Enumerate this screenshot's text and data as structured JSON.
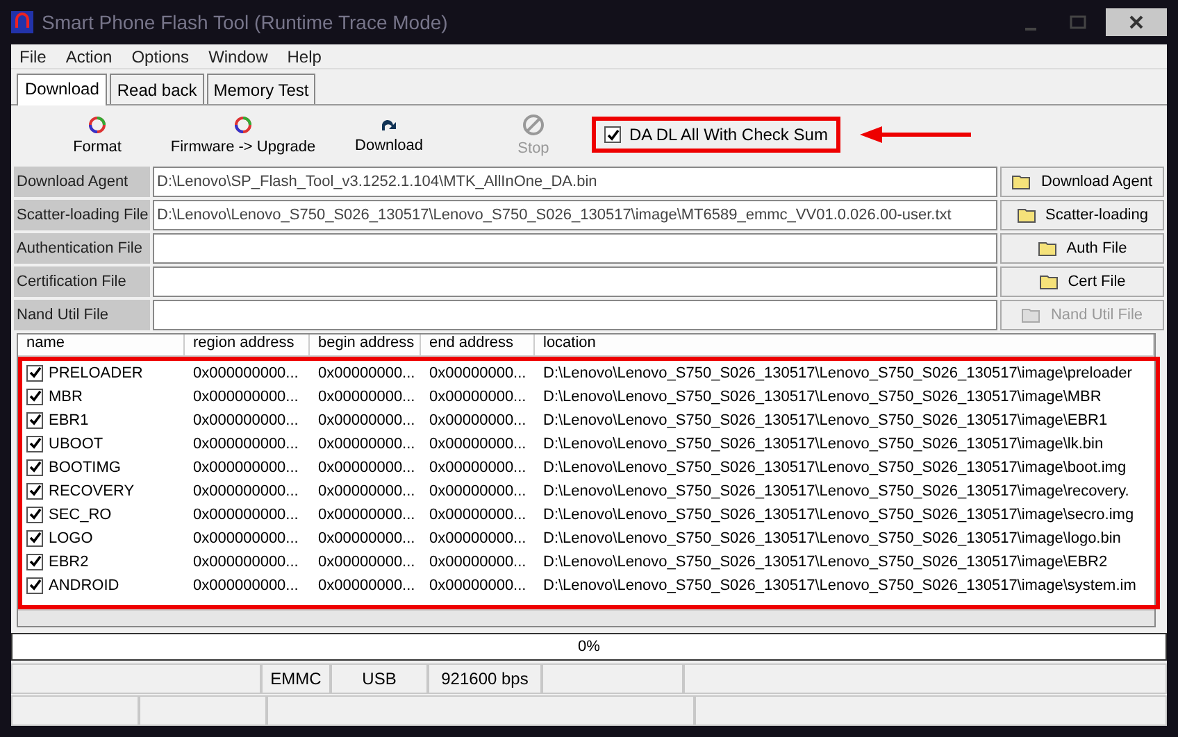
{
  "window": {
    "title": "Smart Phone Flash Tool (Runtime Trace Mode)"
  },
  "menu": [
    "File",
    "Action",
    "Options",
    "Window",
    "Help"
  ],
  "tabs": [
    {
      "label": "Download",
      "selected": true
    },
    {
      "label": "Read back",
      "selected": false
    },
    {
      "label": "Memory Test",
      "selected": false
    }
  ],
  "toolbar": [
    {
      "label": "Format",
      "kind": "format",
      "disabled": false
    },
    {
      "label": "Firmware -> Upgrade",
      "kind": "format",
      "disabled": false
    },
    {
      "label": "Download",
      "kind": "download",
      "disabled": false
    },
    {
      "label": "Stop",
      "kind": "stop",
      "disabled": true
    }
  ],
  "checksum": {
    "label": "DA DL All With Check Sum",
    "checked": true
  },
  "files": [
    {
      "label": "Download Agent",
      "value": "D:\\Lenovo\\SP_Flash_Tool_v3.1252.1.104\\MTK_AllInOne_DA.bin",
      "button": "Download Agent",
      "disabled": false
    },
    {
      "label": "Scatter-loading File",
      "value": "D:\\Lenovo\\Lenovo_S750_S026_130517\\Lenovo_S750_S026_130517\\image\\MT6589_emmc_VV01.0.026.00-user.txt",
      "button": "Scatter-loading",
      "disabled": false
    },
    {
      "label": "Authentication File",
      "button": "Auth File",
      "disabled": false
    },
    {
      "label": "Certification File",
      "button": "Cert File",
      "disabled": false
    },
    {
      "label": "Nand Util File",
      "button": "Nand Util File",
      "disabled": true
    }
  ],
  "table": {
    "columns": [
      "name",
      "region address",
      "begin address",
      "end address",
      "location"
    ],
    "rows": [
      {
        "checked": true,
        "name": "PRELOADER",
        "region": "0x000000000...",
        "begin": "0x00000000...",
        "end": "0x00000000...",
        "location": "D:\\Lenovo\\Lenovo_S750_S026_130517\\Lenovo_S750_S026_130517\\image\\preloader"
      },
      {
        "checked": true,
        "name": "MBR",
        "region": "0x000000000...",
        "begin": "0x00000000...",
        "end": "0x00000000...",
        "location": "D:\\Lenovo\\Lenovo_S750_S026_130517\\Lenovo_S750_S026_130517\\image\\MBR"
      },
      {
        "checked": true,
        "name": "EBR1",
        "region": "0x000000000...",
        "begin": "0x00000000...",
        "end": "0x00000000...",
        "location": "D:\\Lenovo\\Lenovo_S750_S026_130517\\Lenovo_S750_S026_130517\\image\\EBR1"
      },
      {
        "checked": true,
        "name": "UBOOT",
        "region": "0x000000000...",
        "begin": "0x00000000...",
        "end": "0x00000000...",
        "location": "D:\\Lenovo\\Lenovo_S750_S026_130517\\Lenovo_S750_S026_130517\\image\\lk.bin"
      },
      {
        "checked": true,
        "name": "BOOTIMG",
        "region": "0x000000000...",
        "begin": "0x00000000...",
        "end": "0x00000000...",
        "location": "D:\\Lenovo\\Lenovo_S750_S026_130517\\Lenovo_S750_S026_130517\\image\\boot.img"
      },
      {
        "checked": true,
        "name": "RECOVERY",
        "region": "0x000000000...",
        "begin": "0x00000000...",
        "end": "0x00000000...",
        "location": "D:\\Lenovo\\Lenovo_S750_S026_130517\\Lenovo_S750_S026_130517\\image\\recovery."
      },
      {
        "checked": true,
        "name": "SEC_RO",
        "region": "0x000000000...",
        "begin": "0x00000000...",
        "end": "0x00000000...",
        "location": "D:\\Lenovo\\Lenovo_S750_S026_130517\\Lenovo_S750_S026_130517\\image\\secro.img"
      },
      {
        "checked": true,
        "name": "LOGO",
        "region": "0x000000000...",
        "begin": "0x00000000...",
        "end": "0x00000000...",
        "location": "D:\\Lenovo\\Lenovo_S750_S026_130517\\Lenovo_S750_S026_130517\\image\\logo.bin"
      },
      {
        "checked": true,
        "name": "EBR2",
        "region": "0x000000000...",
        "begin": "0x00000000...",
        "end": "0x00000000...",
        "location": "D:\\Lenovo\\Lenovo_S750_S026_130517\\Lenovo_S750_S026_130517\\image\\EBR2"
      },
      {
        "checked": true,
        "name": "ANDROID",
        "region": "0x000000000...",
        "begin": "0x00000000...",
        "end": "0x00000000...",
        "location": "D:\\Lenovo\\Lenovo_S750_S026_130517\\Lenovo_S750_S026_130517\\image\\system.im"
      }
    ]
  },
  "progress": {
    "text": "0%",
    "level": 0
  },
  "status_bar": {
    "row_1": [
      "EMMC",
      "USB",
      "921600 bps"
    ]
  }
}
